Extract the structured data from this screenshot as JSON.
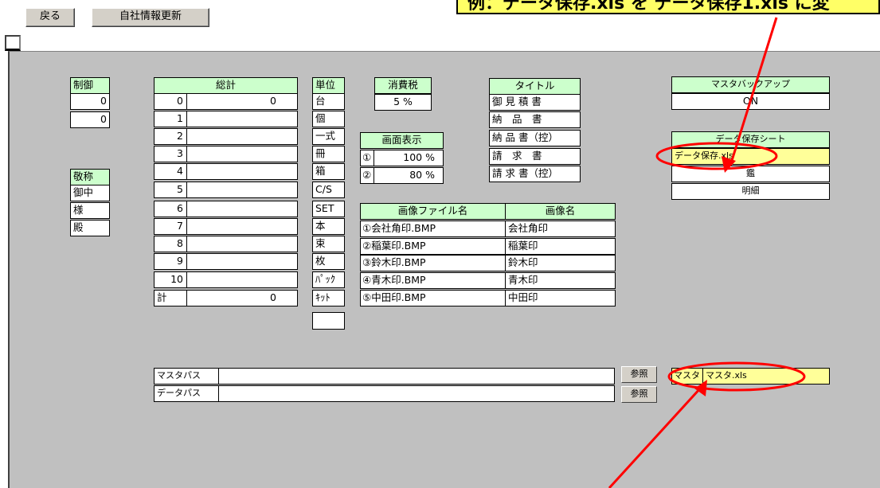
{
  "toolbar": {
    "back_label": "戻る",
    "update_label": "自社情報更新"
  },
  "control": {
    "header": "制御",
    "values": [
      "0",
      "0"
    ]
  },
  "honorific": {
    "header": "敬称",
    "items": [
      "御中",
      "様",
      "殿"
    ]
  },
  "total": {
    "header": "総計",
    "rows": [
      {
        "no": "0",
        "value": "0"
      },
      {
        "no": "1",
        "value": ""
      },
      {
        "no": "2",
        "value": ""
      },
      {
        "no": "3",
        "value": ""
      },
      {
        "no": "4",
        "value": ""
      },
      {
        "no": "5",
        "value": ""
      },
      {
        "no": "6",
        "value": ""
      },
      {
        "no": "7",
        "value": ""
      },
      {
        "no": "8",
        "value": ""
      },
      {
        "no": "9",
        "value": ""
      },
      {
        "no": "10",
        "value": ""
      },
      {
        "no": "計",
        "value": "0"
      }
    ]
  },
  "units": {
    "header": "単位",
    "items": [
      "台",
      "個",
      "一式",
      "冊",
      "箱",
      "C/S",
      "SET",
      "本",
      "束",
      "枚",
      "ﾊﾟｯｸ",
      "ｷｯﾄ",
      ""
    ]
  },
  "tax": {
    "header": "消費税",
    "value": "5 %"
  },
  "display": {
    "header": "画面表示",
    "rows": [
      {
        "mark": "①",
        "value": "100 %"
      },
      {
        "mark": "②",
        "value": "80 %"
      }
    ]
  },
  "titles": {
    "header": "タイトル",
    "items": [
      "御 見 積 書",
      "納　品　書",
      "納 品 書（控）",
      "請　求　書",
      "請 求 書（控）"
    ]
  },
  "images": {
    "header_file": "画像ファイル名",
    "header_name": "画像名",
    "rows": [
      {
        "file": "①会社角印.BMP",
        "name": "会社角印"
      },
      {
        "file": "②稲葉印.BMP",
        "name": "稲葉印"
      },
      {
        "file": "③鈴木印.BMP",
        "name": "鈴木印"
      },
      {
        "file": "④青木印.BMP",
        "name": "青木印"
      },
      {
        "file": "⑤中田印.BMP",
        "name": "中田印"
      }
    ]
  },
  "backup": {
    "header": "マスタバックアップ",
    "value": "ON"
  },
  "save_sheet": {
    "header": "データ保存シート",
    "items": [
      "データ保存.xls",
      "鑑",
      "明細"
    ]
  },
  "paths": {
    "master_label": "マスタパス",
    "master_value": "",
    "data_label": "データパス",
    "data_value": "",
    "ref_label": "参照"
  },
  "master_file": {
    "label": "マスタ",
    "value": "マスタ.xls"
  },
  "callout": {
    "text": "例：データ保存.xls を データ保存1.xls に変"
  },
  "colors": {
    "sheet_bg": "#c0c0c0",
    "header_green": "#ccffcc",
    "highlight_yellow": "#ffff99",
    "annotation_red": "#ff0000",
    "callout_yellow": "#ffff66"
  }
}
